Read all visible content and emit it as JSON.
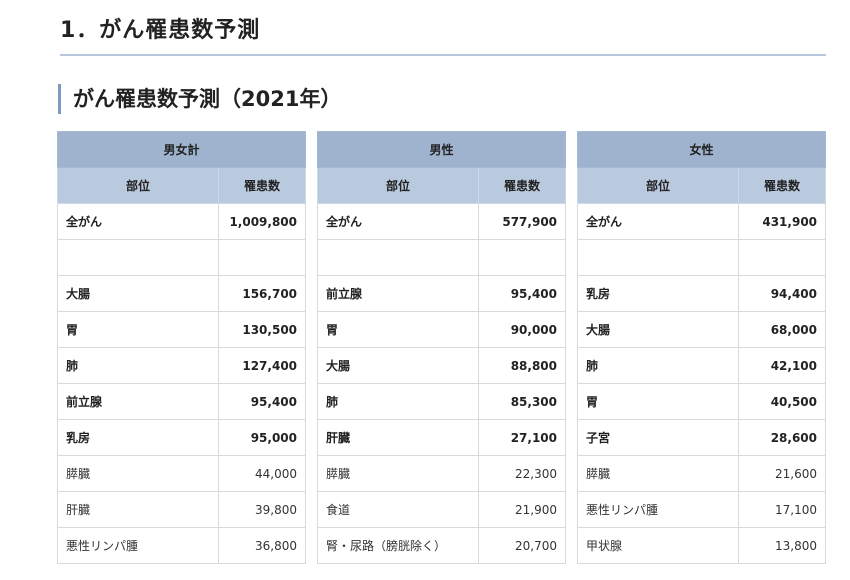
{
  "heading1": "1．がん罹患数予測",
  "heading2": "がん罹患数予測（2021年）",
  "col_site_label": "部位",
  "col_count_label": "罹患数",
  "tables": [
    {
      "title": "男女計",
      "rows": [
        {
          "site": "全がん",
          "count": "1,009,800",
          "bold": true
        },
        {
          "site": "",
          "count": "",
          "bold": true
        },
        {
          "site": "大腸",
          "count": "156,700",
          "bold": true
        },
        {
          "site": "胃",
          "count": "130,500",
          "bold": true
        },
        {
          "site": "肺",
          "count": "127,400",
          "bold": true
        },
        {
          "site": "前立腺",
          "count": "95,400",
          "bold": true
        },
        {
          "site": "乳房",
          "count": "95,000",
          "bold": true
        },
        {
          "site": "膵臓",
          "count": "44,000",
          "bold": false
        },
        {
          "site": "肝臓",
          "count": "39,800",
          "bold": false
        },
        {
          "site": "悪性リンパ腫",
          "count": "36,800",
          "bold": false
        }
      ]
    },
    {
      "title": "男性",
      "rows": [
        {
          "site": "全がん",
          "count": "577,900",
          "bold": true
        },
        {
          "site": "",
          "count": "",
          "bold": true
        },
        {
          "site": "前立腺",
          "count": "95,400",
          "bold": true
        },
        {
          "site": "胃",
          "count": "90,000",
          "bold": true
        },
        {
          "site": "大腸",
          "count": "88,800",
          "bold": true
        },
        {
          "site": "肺",
          "count": "85,300",
          "bold": true
        },
        {
          "site": "肝臓",
          "count": "27,100",
          "bold": true
        },
        {
          "site": "膵臓",
          "count": "22,300",
          "bold": false
        },
        {
          "site": "食道",
          "count": "21,900",
          "bold": false
        },
        {
          "site": "腎・尿路（膀胱除く）",
          "count": "20,700",
          "bold": false
        }
      ]
    },
    {
      "title": "女性",
      "rows": [
        {
          "site": "全がん",
          "count": "431,900",
          "bold": true
        },
        {
          "site": "",
          "count": "",
          "bold": true
        },
        {
          "site": "乳房",
          "count": "94,400",
          "bold": true
        },
        {
          "site": "大腸",
          "count": "68,000",
          "bold": true
        },
        {
          "site": "肺",
          "count": "42,100",
          "bold": true
        },
        {
          "site": "胃",
          "count": "40,500",
          "bold": true
        },
        {
          "site": "子宮",
          "count": "28,600",
          "bold": true
        },
        {
          "site": "膵臓",
          "count": "21,600",
          "bold": false
        },
        {
          "site": "悪性リンパ腫",
          "count": "17,100",
          "bold": false
        },
        {
          "site": "甲状腺",
          "count": "13,800",
          "bold": false
        }
      ]
    }
  ]
}
